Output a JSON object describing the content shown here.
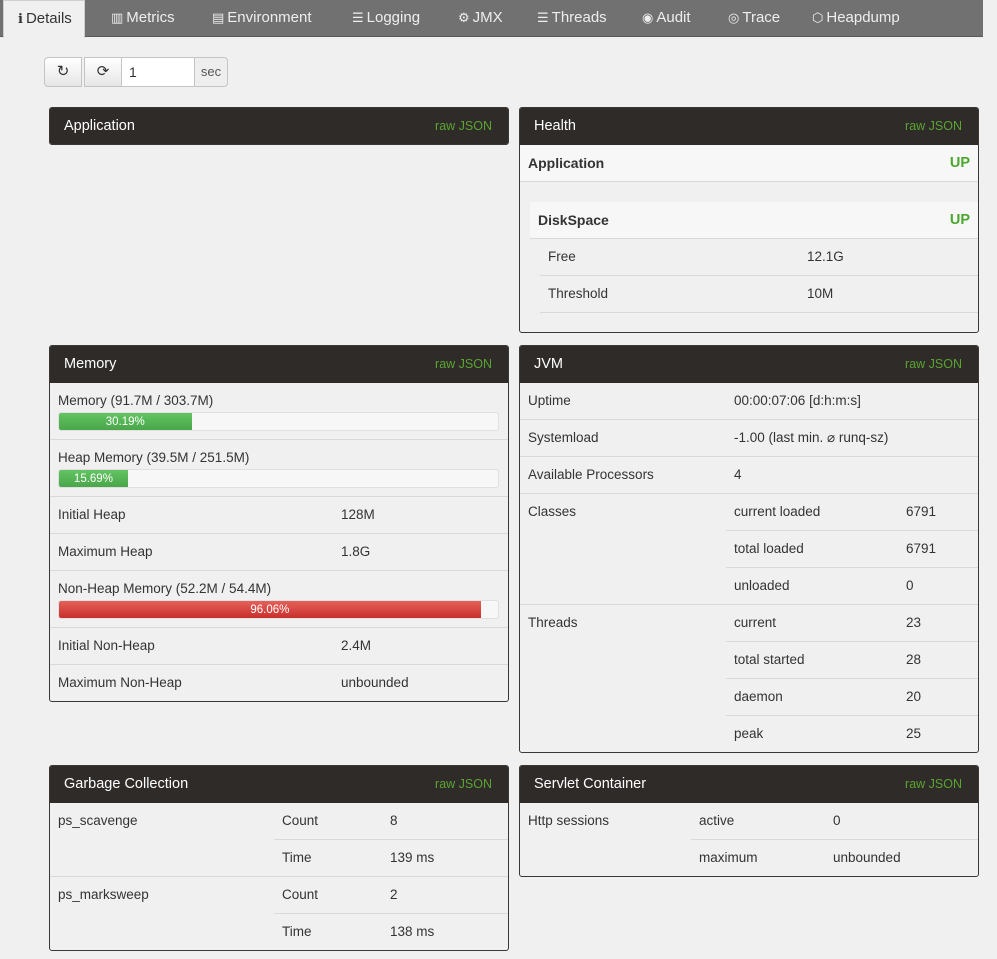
{
  "tabs": [
    {
      "label": "Details",
      "icon": "info-icon",
      "glyph": "i",
      "active": true
    },
    {
      "label": "Metrics",
      "icon": "bar-chart-icon",
      "glyph": "▥"
    },
    {
      "label": "Environment",
      "icon": "list-icon",
      "glyph": "▤"
    },
    {
      "label": "Logging",
      "icon": "sliders-icon",
      "glyph": "☰"
    },
    {
      "label": "JMX",
      "icon": "cogs-icon",
      "glyph": "⚙"
    },
    {
      "label": "Threads",
      "icon": "list-lines-icon",
      "glyph": "☰"
    },
    {
      "label": "Audit",
      "icon": "user-circle-icon",
      "glyph": "◉"
    },
    {
      "label": "Trace",
      "icon": "eye-icon",
      "glyph": "◎"
    },
    {
      "label": "Heapdump",
      "icon": "cubes-icon",
      "glyph": "⬡"
    }
  ],
  "refresh": {
    "refresh_glyph": "↻",
    "auto_glyph": "⟳",
    "interval_value": "1",
    "unit": "sec"
  },
  "raw_json": "raw JSON",
  "application": {
    "title": "Application"
  },
  "health": {
    "title": "Health",
    "app_label": "Application",
    "app_status": "UP",
    "disk_label": "DiskSpace",
    "disk_status": "UP",
    "free_label": "Free",
    "free_value": "12.1G",
    "threshold_label": "Threshold",
    "threshold_value": "10M"
  },
  "memory": {
    "title": "Memory",
    "memory_label": "Memory (91.7M / 303.7M)",
    "memory_pct": "30.19%",
    "memory_fraction": 0.3019,
    "heap_label": "Heap Memory (39.5M / 251.5M)",
    "heap_pct": "15.69%",
    "heap_fraction": 0.1569,
    "initial_heap_label": "Initial Heap",
    "initial_heap_value": "128M",
    "max_heap_label": "Maximum Heap",
    "max_heap_value": "1.8G",
    "nonheap_label": "Non-Heap Memory (52.2M / 54.4M)",
    "nonheap_pct": "96.06%",
    "nonheap_fraction": 0.9606,
    "initial_nonheap_label": "Initial Non-Heap",
    "initial_nonheap_value": "2.4M",
    "max_nonheap_label": "Maximum Non-Heap",
    "max_nonheap_value": "unbounded"
  },
  "jvm": {
    "title": "JVM",
    "uptime_label": "Uptime",
    "uptime_value": "00:00:07:06 [d:h:m:s]",
    "systemload_label": "Systemload",
    "systemload_value": "-1.00 (last min. ⌀ runq-sz)",
    "processors_label": "Available Processors",
    "processors_value": "4",
    "classes_label": "Classes",
    "classes": [
      {
        "label": "current loaded",
        "value": "6791"
      },
      {
        "label": "total loaded",
        "value": "6791"
      },
      {
        "label": "unloaded",
        "value": "0"
      }
    ],
    "threads_label": "Threads",
    "threads": [
      {
        "label": "current",
        "value": "23"
      },
      {
        "label": "total started",
        "value": "28"
      },
      {
        "label": "daemon",
        "value": "20"
      },
      {
        "label": "peak",
        "value": "25"
      }
    ]
  },
  "gc": {
    "title": "Garbage Collection",
    "collectors": [
      {
        "name": "ps_scavenge",
        "count_label": "Count",
        "count": "8",
        "time_label": "Time",
        "time": "139 ms"
      },
      {
        "name": "ps_marksweep",
        "count_label": "Count",
        "count": "2",
        "time_label": "Time",
        "time": "138 ms"
      }
    ]
  },
  "servlet": {
    "title": "Servlet Container",
    "sessions_label": "Http sessions",
    "active_label": "active",
    "active_value": "0",
    "maximum_label": "maximum",
    "maximum_value": "unbounded"
  }
}
